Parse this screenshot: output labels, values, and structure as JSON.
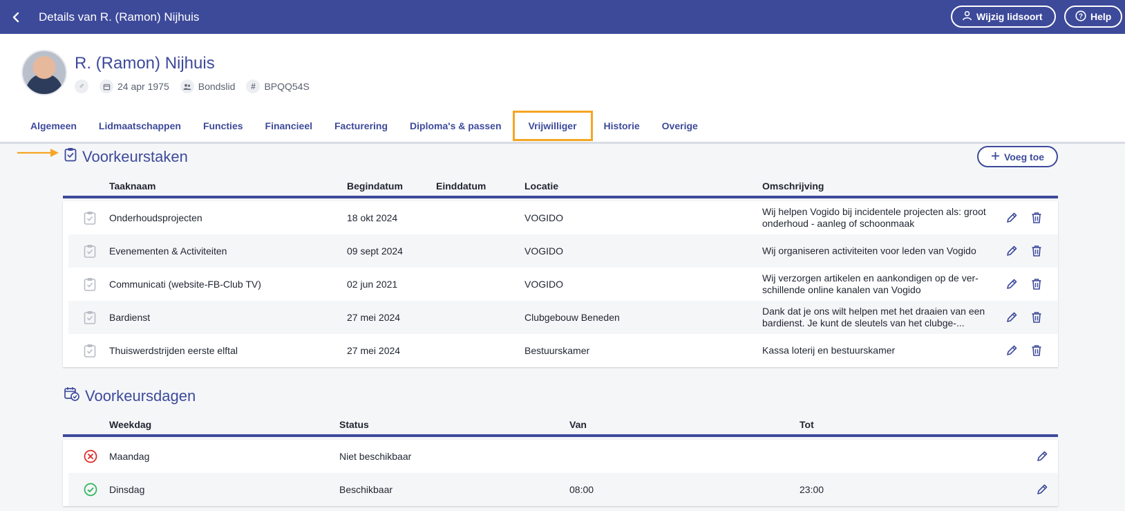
{
  "topbar": {
    "title": "Details van R. (Ramon) Nijhuis",
    "change_membership_label": "Wijzig lidsoort",
    "help_label": "Help"
  },
  "profile": {
    "name": "R. (Ramon) Nijhuis",
    "gender_symbol": "♂",
    "birthdate": "24 apr 1975",
    "membership": "Bondslid",
    "code": "BPQQ54S"
  },
  "tabs": [
    {
      "label": "Algemeen"
    },
    {
      "label": "Lidmaatschappen"
    },
    {
      "label": "Functies"
    },
    {
      "label": "Financieel"
    },
    {
      "label": "Facturering"
    },
    {
      "label": "Diploma's & passen"
    },
    {
      "label": "Vrijwilliger",
      "active": true
    },
    {
      "label": "Historie"
    },
    {
      "label": "Overige"
    }
  ],
  "tasks": {
    "title": "Voorkeurstaken",
    "add_label": "Voeg toe",
    "columns": {
      "name": "Taaknaam",
      "start": "Begindatum",
      "end": "Einddatum",
      "location": "Locatie",
      "description": "Omschrijving"
    },
    "rows": [
      {
        "name": "Onderhoudsprojecten",
        "start": "18 okt 2024",
        "end": "",
        "location": "VOGIDO",
        "description": "Wij helpen Vogido bij incidentele projecten als: groot onderhoud - aanleg of schoonmaak"
      },
      {
        "name": "Evenementen & Activiteiten",
        "start": "09 sept 2024",
        "end": "",
        "location": "VOGIDO",
        "description": "Wij organiseren activiteiten voor leden van Vogido"
      },
      {
        "name": "Communicati (website-FB-Club TV)",
        "start": "02 jun 2021",
        "end": "",
        "location": "VOGIDO",
        "description": "Wij verzorgen artikelen en aankondigen op de ver-schillende online kanalen van Vogido"
      },
      {
        "name": "Bardienst",
        "start": "27 mei 2024",
        "end": "",
        "location": "Clubgebouw Beneden",
        "description": "Dank dat je ons wilt helpen met het draaien van een bardienst. Je kunt de sleutels van het clubge-..."
      },
      {
        "name": "Thuiswerdstrijden eerste elftal",
        "start": "27 mei 2024",
        "end": "",
        "location": "Bestuurskamer",
        "description": "Kassa loterij en bestuurskamer"
      }
    ]
  },
  "days": {
    "title": "Voorkeursdagen",
    "columns": {
      "weekday": "Weekdag",
      "status": "Status",
      "from": "Van",
      "to": "Tot"
    },
    "rows": [
      {
        "weekday": "Maandag",
        "status": "Niet beschikbaar",
        "from": "",
        "to": "",
        "available": false
      },
      {
        "weekday": "Dinsdag",
        "status": "Beschikbaar",
        "from": "08:00",
        "to": "23:00",
        "available": true
      }
    ]
  },
  "colors": {
    "brand": "#3d4a9a",
    "highlight": "#f5a623",
    "unavailable": "#e02424",
    "available": "#2bb35a"
  }
}
